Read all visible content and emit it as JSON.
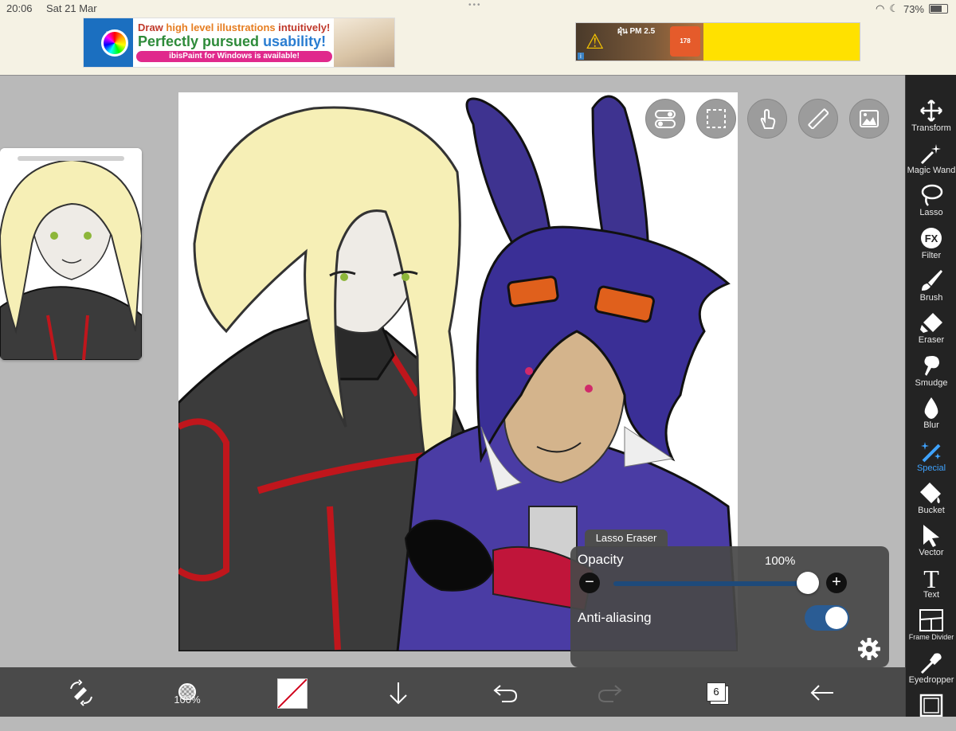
{
  "status_bar": {
    "time": "20:06",
    "date": "Sat 21 Mar",
    "battery": "73%"
  },
  "ads": {
    "ibis": {
      "line1_red": "Draw ",
      "line1_orange": "high level illustrations",
      "line1_end": " intuitively!",
      "line2_green": "Perfectly pursued ",
      "line2_blue": "usability!",
      "line3": "ibisPaint for Windows is available!"
    },
    "pm": {
      "title": "ฝุ่น PM 2.5",
      "badge": "178",
      "info": "i"
    }
  },
  "tools": [
    {
      "label": "Transform",
      "icon": "move-arrows-icon"
    },
    {
      "label": "Magic Wand",
      "icon": "magic-wand-icon"
    },
    {
      "label": "Lasso",
      "icon": "lasso-icon"
    },
    {
      "label": "Filter",
      "icon": "fx-icon",
      "glyph": "FX"
    },
    {
      "label": "Brush",
      "icon": "brush-icon"
    },
    {
      "label": "Eraser",
      "icon": "eraser-icon"
    },
    {
      "label": "Smudge",
      "icon": "smudge-icon"
    },
    {
      "label": "Blur",
      "icon": "blur-drop-icon"
    },
    {
      "label": "Special",
      "icon": "special-wand-icon",
      "active": true
    },
    {
      "label": "Bucket",
      "icon": "bucket-icon"
    },
    {
      "label": "Vector",
      "icon": "vector-cursor-icon"
    },
    {
      "label": "Text",
      "icon": "text-icon",
      "glyph": "T"
    },
    {
      "label": "Frame Divider",
      "icon": "frame-divider-icon"
    },
    {
      "label": "Eyedropper",
      "icon": "eyedropper-icon"
    }
  ],
  "bottom_bar": {
    "brush_size": "100%",
    "layers_count": "6"
  },
  "popup": {
    "tab": "Lasso Eraser",
    "opacity_label": "Opacity",
    "opacity_value": "100%",
    "opacity_level": 1.0,
    "minus": "−",
    "plus": "+",
    "antialias_label": "Anti-aliasing",
    "antialias_on": true
  },
  "colors": {
    "accent": "#3fa3ff",
    "toolbar": "#232323",
    "bottom_bar": "#4a4a4a",
    "toggle_on": "#2a5c94"
  }
}
